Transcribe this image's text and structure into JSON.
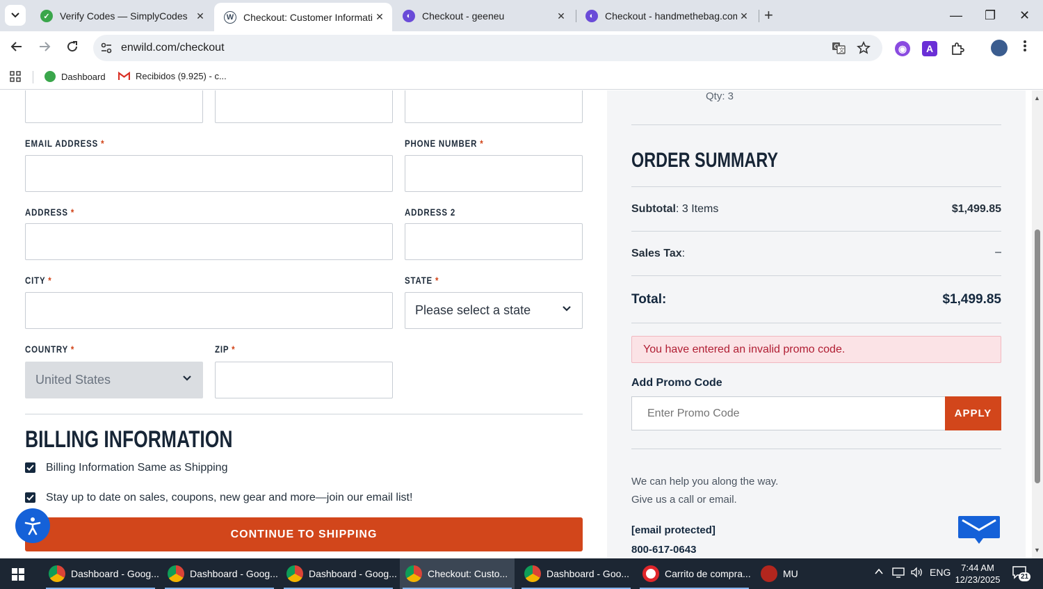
{
  "browser": {
    "tabs": [
      {
        "title": "Verify Codes — SimplyCodes",
        "icon": "simplycodes-icon",
        "active": false
      },
      {
        "title": "Checkout: Customer Informatio",
        "icon": "wordpress-icon",
        "active": true
      },
      {
        "title": "Checkout - geeneu",
        "icon": "shop-icon",
        "active": false
      },
      {
        "title": "Checkout - handmethebag.com",
        "icon": "shop-icon",
        "active": false
      }
    ],
    "url": "enwild.com/checkout",
    "bookmarks": [
      {
        "label": "Dashboard",
        "icon": "dashboard-icon"
      },
      {
        "label": "Recibidos (9.925) - c...",
        "icon": "gmail-icon"
      }
    ]
  },
  "checkout": {
    "email_label": "EMAIL ADDRESS",
    "phone_label": "PHONE NUMBER",
    "address_label": "ADDRESS",
    "address2_label": "ADDRESS 2",
    "city_label": "CITY",
    "state_label": "STATE",
    "state_value": "Please select a state",
    "country_label": "COUNTRY",
    "country_value": "United States",
    "zip_label": "ZIP",
    "required_mark": "*",
    "billing_title": "BILLING INFORMATION",
    "billing_same_label": "Billing Information Same as Shipping",
    "newsletter_label": "Stay up to date on sales, coupons, new gear and more—join our email list!",
    "continue_label": "CONTINUE TO SHIPPING"
  },
  "summary": {
    "qty_text": "Qty: 3",
    "title": "ORDER SUMMARY",
    "subtotal_label": "Subtotal",
    "subtotal_items": ": 3 Items",
    "subtotal_value": "$1,499.85",
    "tax_label": "Sales Tax",
    "tax_colon": ":",
    "tax_value": "–",
    "total_label": "Total:",
    "total_value": "$1,499.85",
    "promo_error": "You have entered an invalid promo code.",
    "promo_label": "Add Promo Code",
    "promo_placeholder": "Enter Promo Code",
    "apply_label": "APPLY",
    "help_line1": "We can help you along the way.",
    "help_line2": "Give us a call or email.",
    "email": "[email protected]",
    "phone": "800-617-0643"
  },
  "taskbar": {
    "items": [
      {
        "label": "Dashboard - Goog...",
        "icon": "chrome-icon"
      },
      {
        "label": "Dashboard - Goog...",
        "icon": "chrome-icon"
      },
      {
        "label": "Dashboard - Goog...",
        "icon": "chrome-icon"
      },
      {
        "label": "Checkout: Custo...",
        "icon": "chrome-icon",
        "active": true
      },
      {
        "label": "Dashboard - Goo...",
        "icon": "chrome-icon"
      },
      {
        "label": "Carrito de compra...",
        "icon": "opera-icon"
      },
      {
        "label": "MU",
        "icon": "mu-icon"
      }
    ],
    "lang": "ENG",
    "time": "7:44 AM",
    "date": "12/23/2025",
    "notifications": "21"
  },
  "colors": {
    "accent": "#d2461b",
    "navy": "#14283e",
    "error_bg": "#fbe3e6"
  }
}
